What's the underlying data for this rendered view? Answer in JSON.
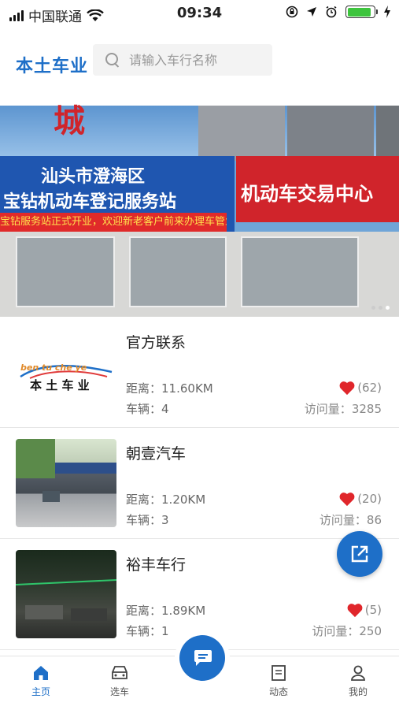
{
  "status_bar": {
    "carrier": "中国联通",
    "time": "09:34",
    "battery_level": 0.9
  },
  "header": {
    "logo_text": "本土车业",
    "search_placeholder": "请输入车行名称"
  },
  "banner": {
    "sign_line1": "汕头市澄海区",
    "sign_line2": "宝钻机动车登记服务站",
    "sign_red": "机动车交易中心",
    "strip_text": "宝钻服务站正式开业，欢迎新老客户前来办理车管业务",
    "top_red_text": "城",
    "slide_count": 3,
    "active_slide": 3
  },
  "dealers": [
    {
      "name": "官方联系",
      "distance_label": "距离：",
      "distance": "11.60KM",
      "vehicles_label": "车辆：",
      "vehicles": "4",
      "likes": "(62)",
      "visits_label": "访问量：",
      "visits": "3285",
      "logo_sub": "ben tu che ye",
      "logo_main": "本 土 车 业"
    },
    {
      "name": "朝壹汽车",
      "distance_label": "距离：",
      "distance": "1.20KM",
      "vehicles_label": "车辆：",
      "vehicles": "3",
      "likes": "(20)",
      "visits_label": "访问量：",
      "visits": "86"
    },
    {
      "name": "裕丰车行",
      "distance_label": "距离：",
      "distance": "1.89KM",
      "vehicles_label": "车辆：",
      "vehicles": "1",
      "likes": "(5)",
      "visits_label": "访问量：",
      "visits": "250"
    }
  ],
  "tabbar": {
    "home": "主页",
    "select_car": "选车",
    "news": "动态",
    "mine": "我的"
  },
  "colors": {
    "accent": "#1e6fc8",
    "heart": "#e0262b"
  }
}
